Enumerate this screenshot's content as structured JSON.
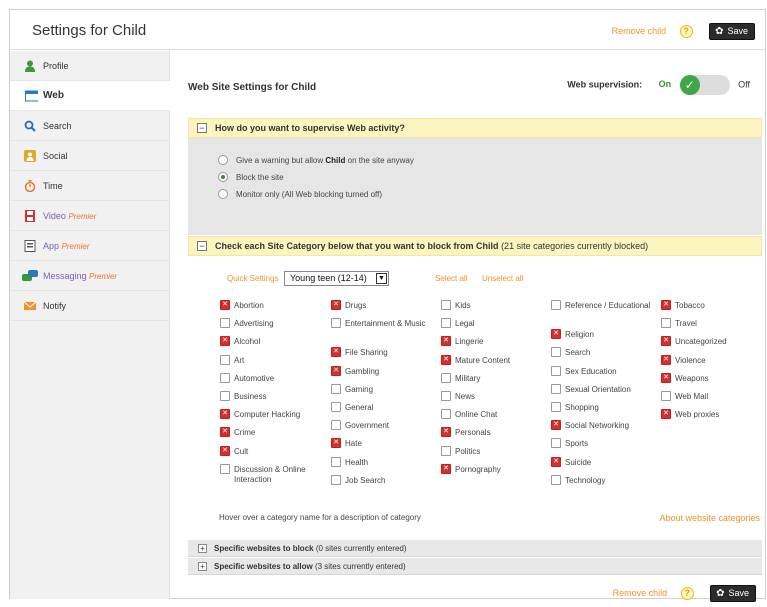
{
  "header": {
    "title": "Settings for Child",
    "remove_child": "Remove child",
    "help": "?",
    "save": "Save"
  },
  "sidebar": {
    "items": [
      {
        "label": "Profile",
        "icon": "person-icon",
        "color": "#3a9a3a"
      },
      {
        "label": "Web",
        "icon": "browser-window-icon",
        "color": "#2a7ab8"
      },
      {
        "label": "Search",
        "icon": "magnifier-icon",
        "color": "#2a6ab8"
      },
      {
        "label": "Social",
        "icon": "social-icon",
        "color": "#e2a72a"
      },
      {
        "label": "Time",
        "icon": "stopwatch-icon",
        "color": "#e8762d"
      },
      {
        "label": "Video",
        "premier": "Premier",
        "icon": "film-icon",
        "color": "#d3302e"
      },
      {
        "label": "App",
        "premier": "Premier",
        "icon": "app-document-icon",
        "color": "#555555"
      },
      {
        "label": "Messaging",
        "premier": "Premier",
        "icon": "chat-bubbles-icon",
        "color": "#3a9a3a"
      },
      {
        "label": "Notify",
        "icon": "envelope-icon",
        "color": "#f0932b"
      }
    ]
  },
  "main": {
    "title": "Web Site Settings for Child",
    "supervision_label": "Web supervision:",
    "on": "On",
    "off": "Off",
    "supervise_section": {
      "title": "How do you want to supervise Web activity?",
      "options": [
        {
          "pre": "Give a warning but allow ",
          "bold": "Child",
          "post": " on the site anyway",
          "checked": false
        },
        {
          "pre": "Block the site",
          "bold": "",
          "post": "",
          "checked": true
        },
        {
          "pre": "Monitor only (All Web blocking turned off)",
          "bold": "",
          "post": "",
          "checked": false
        }
      ]
    },
    "category_section": {
      "title": "Check each Site Category below that you want to block from Child",
      "count_note": "(21 site categories currently blocked)",
      "quick_settings": "Quick Settings",
      "quick_value": "Young teen (12-14)",
      "select_all": "Select all",
      "unselect_all": "Unselect all",
      "columns": [
        [
          {
            "label": "Abortion",
            "blocked": true
          },
          {
            "label": "Advertising",
            "blocked": false
          },
          {
            "label": "Alcohol",
            "blocked": true
          },
          {
            "label": "Art",
            "blocked": false
          },
          {
            "label": "Automotive",
            "blocked": false
          },
          {
            "label": "Business",
            "blocked": false
          },
          {
            "label": "Computer Hacking",
            "blocked": true
          },
          {
            "label": "Crime",
            "blocked": true
          },
          {
            "label": "Cult",
            "blocked": true
          },
          {
            "label": "Discussion & Online Interaction",
            "blocked": false
          }
        ],
        [
          {
            "label": "Drugs",
            "blocked": true
          },
          {
            "label": "Entertainment & Music",
            "blocked": false
          },
          {
            "label": "File Sharing",
            "blocked": true
          },
          {
            "label": "Gambling",
            "blocked": true
          },
          {
            "label": "Gaming",
            "blocked": false
          },
          {
            "label": "General",
            "blocked": false
          },
          {
            "label": "Government",
            "blocked": false
          },
          {
            "label": "Hate",
            "blocked": true
          },
          {
            "label": "Health",
            "blocked": false
          },
          {
            "label": "Job Search",
            "blocked": false
          }
        ],
        [
          {
            "label": "Kids",
            "blocked": false
          },
          {
            "label": "Legal",
            "blocked": false
          },
          {
            "label": "Lingerie",
            "blocked": true
          },
          {
            "label": "Mature Content",
            "blocked": true
          },
          {
            "label": "Military",
            "blocked": false
          },
          {
            "label": "News",
            "blocked": false
          },
          {
            "label": "Online Chat",
            "blocked": false
          },
          {
            "label": "Personals",
            "blocked": true
          },
          {
            "label": "Politics",
            "blocked": false
          },
          {
            "label": "Pornography",
            "blocked": true
          }
        ],
        [
          {
            "label": "Reference / Educational",
            "blocked": false
          },
          {
            "label": "Religion",
            "blocked": true
          },
          {
            "label": "Search",
            "blocked": false
          },
          {
            "label": "Sex Education",
            "blocked": false
          },
          {
            "label": "Sexual Orientation",
            "blocked": false
          },
          {
            "label": "Shopping",
            "blocked": false
          },
          {
            "label": "Social Networking",
            "blocked": true
          },
          {
            "label": "Sports",
            "blocked": false
          },
          {
            "label": "Suicide",
            "blocked": true
          },
          {
            "label": "Technology",
            "blocked": false
          }
        ],
        [
          {
            "label": "Tobacco",
            "blocked": true
          },
          {
            "label": "Travel",
            "blocked": false
          },
          {
            "label": "Uncategorized",
            "blocked": true
          },
          {
            "label": "Violence",
            "blocked": true
          },
          {
            "label": "Weapons",
            "blocked": true
          },
          {
            "label": "Web Mail",
            "blocked": false
          },
          {
            "label": "Web proxies",
            "blocked": true
          }
        ]
      ],
      "hover_note": "Hover over a category name for a description of category",
      "about_link": "About website categories"
    },
    "block_sites": {
      "title": "Specific websites to block",
      "note": "(0 sites currently entered)"
    },
    "allow_sites": {
      "title": "Specific websites to allow",
      "note": "(3 sites currently entered)"
    }
  },
  "footer": {
    "remove_child": "Remove child",
    "help": "?",
    "save": "Save"
  }
}
